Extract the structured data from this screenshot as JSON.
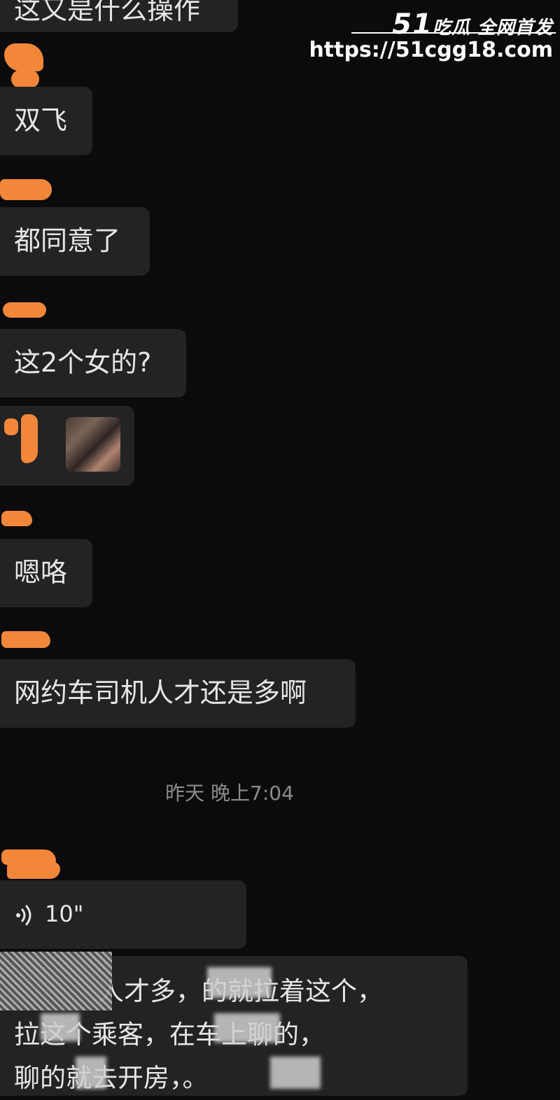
{
  "watermark": {
    "brand_num": "51",
    "brand_text": "吃瓜 全网首发",
    "url": "https://51cgg18.com"
  },
  "messages": [
    {
      "text": "这又是什么操作"
    },
    {
      "text": "双飞"
    },
    {
      "text": "都同意了"
    },
    {
      "text": "这2个女的?"
    },
    {
      "text": "嗯咯"
    },
    {
      "text": "网约车司机人才还是多啊"
    }
  ],
  "timestamp": "昨天 晚上7:04",
  "voice": {
    "duration": "10\"",
    "icon": "voice-wave-icon"
  },
  "image_message": {
    "icon": "photo-thumbnail"
  },
  "long_message": {
    "line1": "人才多，的就拉着这个，",
    "line2": "拉这个乘客，在车上聊的，",
    "line3": "聊的就去开房，。"
  },
  "colors": {
    "background": "#0b0b0d",
    "bubble": "#232325",
    "redaction": "#f2873a",
    "timestamp": "#8c8c8c"
  }
}
